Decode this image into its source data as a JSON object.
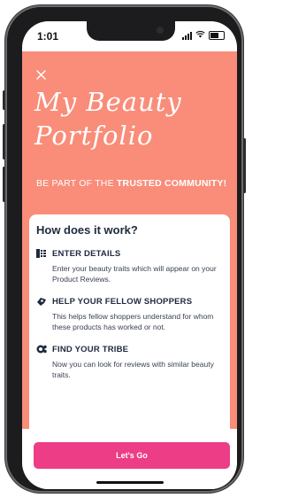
{
  "status": {
    "time": "1:01"
  },
  "header": {
    "close_icon": "close-icon",
    "title_line1": "My Beauty",
    "title_line2": "Portfolio",
    "tagline_prefix": "BE PART OF THE ",
    "tagline_bold": "TRUSTED COMMUNITY!"
  },
  "card": {
    "heading": "How does it work?",
    "steps": [
      {
        "icon": "details-list-icon",
        "title": "ENTER DETAILS",
        "text": "Enter your beauty traits which will appear on your Product Reviews."
      },
      {
        "icon": "help-hand-icon",
        "title": "HELP YOUR FELLOW SHOPPERS",
        "text": "This helps fellow shoppers understand for whom these products has worked or not."
      },
      {
        "icon": "tribe-icon",
        "title": "FIND YOUR TRIBE",
        "text": "Now you can look for reviews with similar beauty traits."
      }
    ]
  },
  "footer": {
    "cta_label": "Let's Go"
  },
  "colors": {
    "hero": "#f98d79",
    "cta": "#ec3d86",
    "heading": "#1d2a3d"
  }
}
